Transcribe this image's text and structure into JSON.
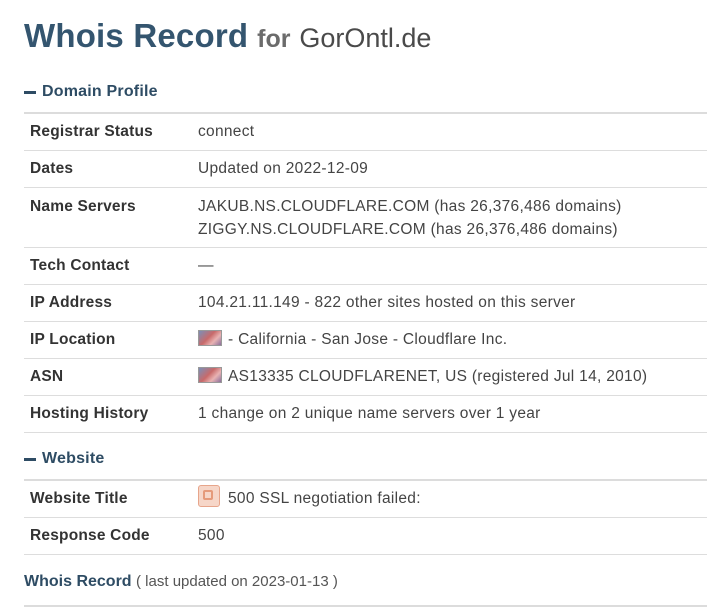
{
  "header": {
    "title": "Whois Record",
    "for": "for",
    "domain": "GorOntl.de"
  },
  "domain_profile": {
    "heading": "Domain Profile",
    "rows": {
      "registrar_status": {
        "label": "Registrar Status",
        "value": "connect"
      },
      "dates": {
        "label": "Dates",
        "value": "Updated on 2022-12-09"
      },
      "name_servers": {
        "label": "Name Servers",
        "ns1": "JAKUB.NS.CLOUDFLARE.COM (has 26,376,486 domains)",
        "ns2": "ZIGGY.NS.CLOUDFLARE.COM (has 26,376,486 domains)"
      },
      "tech_contact": {
        "label": "Tech Contact",
        "value": "—"
      },
      "ip_address": {
        "label": "IP Address",
        "value": "104.21.11.149 - 822 other sites hosted on this server"
      },
      "ip_location": {
        "label": "IP Location",
        "value": "- California - San Jose - Cloudflare Inc.",
        "flag_icon": "us-flag-icon"
      },
      "asn": {
        "label": "ASN",
        "value": "AS13335 CLOUDFLARENET, US (registered Jul 14, 2010)",
        "flag_icon": "us-flag-icon"
      },
      "hosting_history": {
        "label": "Hosting History",
        "value": "1 change on 2 unique name servers over 1 year"
      }
    }
  },
  "website": {
    "heading": "Website",
    "rows": {
      "website_title": {
        "label": "Website Title",
        "value": "500 SSL negotiation failed:",
        "icon": "site-favicon-icon"
      },
      "response_code": {
        "label": "Response Code",
        "value": "500"
      }
    }
  },
  "whois_record": {
    "title": "Whois Record",
    "subtitle": "( last updated on 2023-01-13 )"
  },
  "colors": {
    "heading": "#34556f",
    "section": "#2e4c64",
    "border": "#dddddd"
  }
}
